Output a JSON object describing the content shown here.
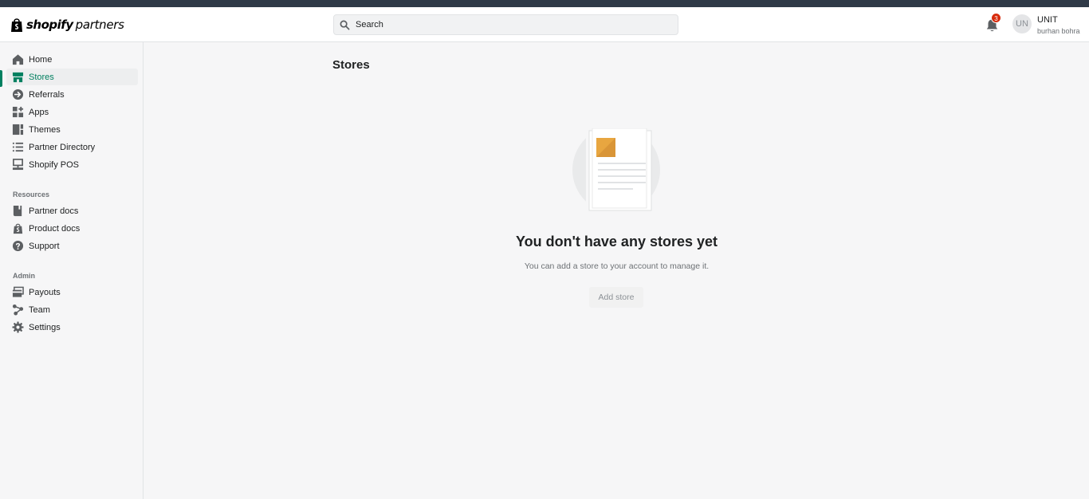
{
  "brand": {
    "name_bold": "shopify",
    "name_light": "partners"
  },
  "search": {
    "placeholder": "Search"
  },
  "notifications": {
    "count": "3"
  },
  "user": {
    "initials": "UN",
    "name": "UNIT",
    "subtitle": "burhan bohra"
  },
  "sidebar": {
    "main_items": [
      {
        "label": "Home",
        "icon": "home-icon"
      },
      {
        "label": "Stores",
        "icon": "store-icon",
        "active": true
      },
      {
        "label": "Referrals",
        "icon": "referral-icon"
      },
      {
        "label": "Apps",
        "icon": "apps-icon"
      },
      {
        "label": "Themes",
        "icon": "themes-icon"
      },
      {
        "label": "Partner Directory",
        "icon": "list-icon"
      },
      {
        "label": "Shopify POS",
        "icon": "pos-icon"
      }
    ],
    "resources_title": "Resources",
    "resources_items": [
      {
        "label": "Partner docs",
        "icon": "book-icon"
      },
      {
        "label": "Product docs",
        "icon": "shopify-bag-icon"
      },
      {
        "label": "Support",
        "icon": "question-icon"
      }
    ],
    "admin_title": "Admin",
    "admin_items": [
      {
        "label": "Payouts",
        "icon": "payouts-icon"
      },
      {
        "label": "Team",
        "icon": "team-icon"
      },
      {
        "label": "Settings",
        "icon": "gear-icon"
      }
    ]
  },
  "main": {
    "page_title": "Stores",
    "empty_title": "You don't have any stores yet",
    "empty_subtitle": "You can add a store to your account to manage it.",
    "add_store_label": "Add store"
  },
  "colors": {
    "accent": "#008060",
    "topstrip": "#2f3a47",
    "badge": "#d72c0d"
  }
}
